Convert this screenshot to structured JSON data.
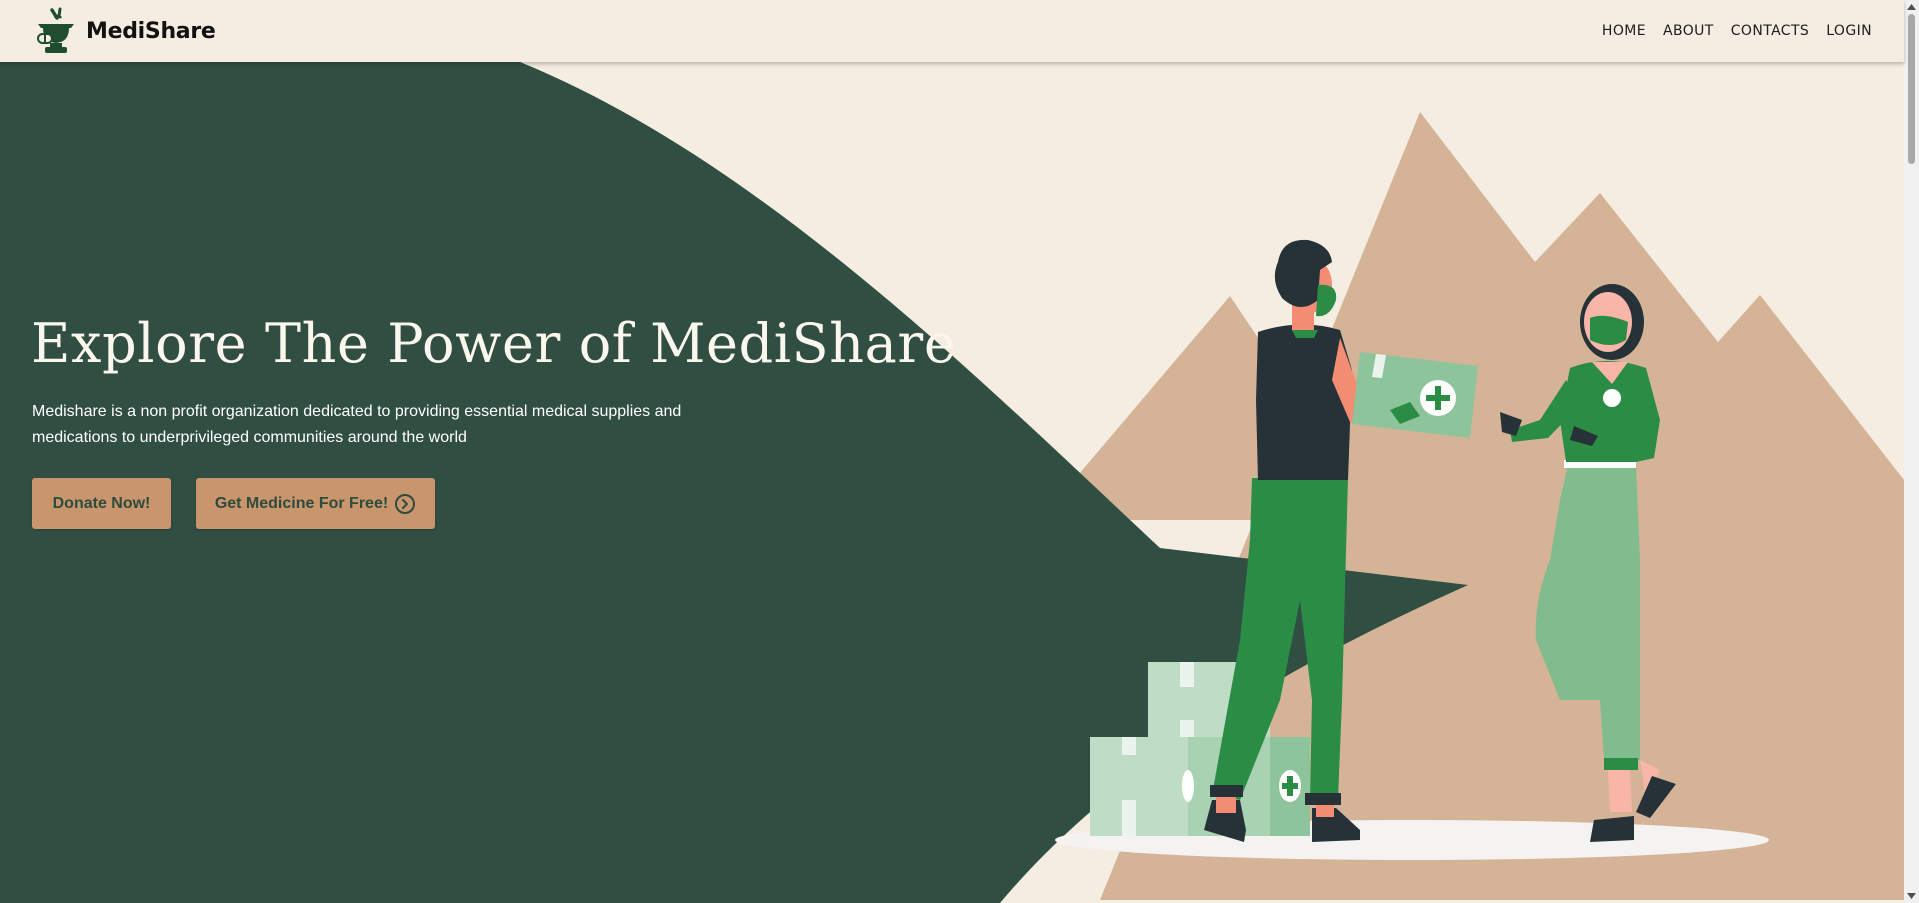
{
  "navbar": {
    "brand": "MediShare",
    "links": [
      {
        "label": "HOME"
      },
      {
        "label": "ABOUT"
      },
      {
        "label": "CONTACTS"
      },
      {
        "label": "LOGIN"
      }
    ]
  },
  "hero": {
    "title": "Explore The Power of MediShare",
    "description": "Medishare is a non profit organization dedicated to providing essential medical supplies and medications to underprivileged communities around the world",
    "buttons": {
      "donate": "Donate Now!",
      "free": "Get Medicine For Free!"
    }
  },
  "icons": {
    "logo": "mortar-pestle-pill-icon",
    "button_arrow": "circle-chevron-right-icon"
  },
  "colors": {
    "background": "#f5ede2",
    "hero_dark": "#314e43",
    "button": "#c9956c",
    "mountain": "#d4b396",
    "accent_green": "#2a8c45"
  }
}
